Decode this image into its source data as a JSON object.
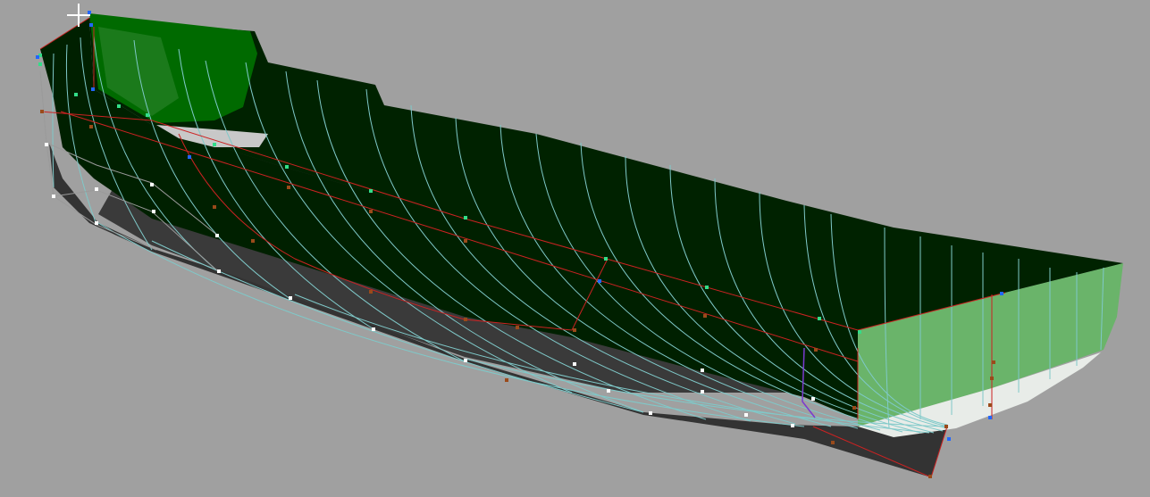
{
  "viewport": {
    "background": "#a0a0a0",
    "hull_inner_color": "#002000",
    "hull_topside_color": "#006a00",
    "hull_bottom_color": "#303030",
    "transom_color": "#6ab46a",
    "station_line_color": "#7fc9c9",
    "control_net_color": "#cc2222",
    "cursor_icon": "crosshair-icon"
  }
}
